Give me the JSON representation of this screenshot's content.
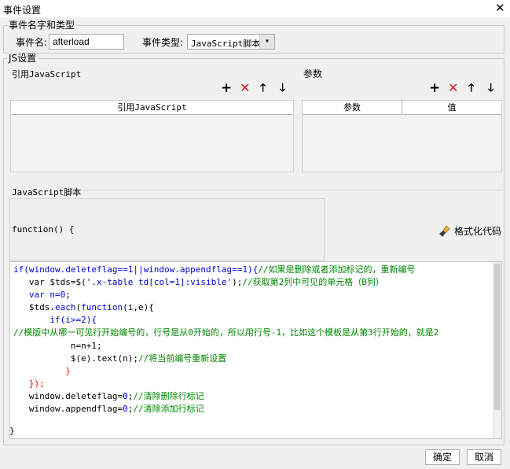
{
  "window": {
    "title": "事件设置",
    "close_glyph": "✕"
  },
  "event_group": {
    "legend": "事件名字和类型",
    "name_label": "事件名:",
    "name_value": "afterload",
    "type_label": "事件类型:",
    "type_value": "JavaScript脚本"
  },
  "js_group": {
    "legend": "JS设置",
    "ref_section_label": "引用JavaScript",
    "ref_column": "引用JavaScript",
    "param_section_label": "参数",
    "param_columns": [
      "参数",
      "值"
    ],
    "script_section_label": "JavaScript脚本",
    "function_header": "function() {",
    "format_button": "格式化代码",
    "closing_brace": "}"
  },
  "toolbar_glyphs": {
    "add": "+",
    "delete": "✕",
    "up": "🡑",
    "down": "🡓"
  },
  "code_lines": {
    "l1a": "if(window.deleteflag==1||window.appendflag==1){",
    "l1c": "//如果是删除或者添加标记的，重新编号",
    "l2a": "   var $tds=$(",
    "l2s": "'.x-table td[col=1]:visible'",
    "l2b": ");",
    "l2c": "//获取第2列中可见的单元格（B列）",
    "l3a": "   var n=",
    "l3n": "0",
    "l3b": ";",
    "l4a": "   $tds.",
    "l4e": "each",
    "l4b": "(",
    "l4f": "function",
    "l4d": "(i,e){",
    "l5a": "       if(i>=2){",
    "l6c": "//模版中从哪一可见行开始编号的，行号是从0开始的，所以用行号-1，比如这个模板是从第3行开始的，就是2",
    "l7a": "           n=n+1;",
    "l8a": "           $(e).text(n);",
    "l8c": "//将当前编号重新设置",
    "l9a": "          }",
    "l10a": "   });",
    "l11a": "   window.deleteflag=",
    "l11n": "0",
    "l11b": ";",
    "l11c": "//清除删除行标记",
    "l12a": "   window.appendflag=",
    "l12n": "0",
    "l12b": ";",
    "l12c": "//清除添加行标记"
  },
  "buttons": {
    "ok": "确定",
    "cancel": "取消"
  }
}
